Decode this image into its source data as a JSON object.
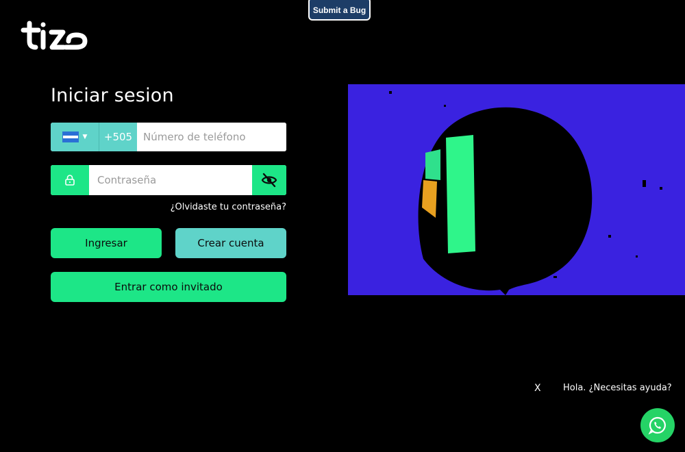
{
  "bug_button": {
    "label": "Submit a Bug"
  },
  "logo": {
    "alt": "tizo"
  },
  "login": {
    "title": "Iniciar sesion",
    "phone": {
      "prefix": "+505",
      "placeholder": "Número de teléfono",
      "value": "",
      "flag_icon": "nicaragua-flag-icon"
    },
    "password": {
      "placeholder": "Contraseña",
      "value": ""
    },
    "forgot_label": "¿Olvidaste tu contraseña?",
    "login_label": "Ingresar",
    "create_label": "Crear cuenta",
    "guest_label": "Entrar como invitado"
  },
  "help": {
    "close_label": "X",
    "message": "Hola. ¿Necesitas ayuda?"
  },
  "colors": {
    "accent_green": "#1de687",
    "accent_teal": "#5fd3c9",
    "art_blue": "#3a22e0",
    "whatsapp": "#25d366"
  }
}
